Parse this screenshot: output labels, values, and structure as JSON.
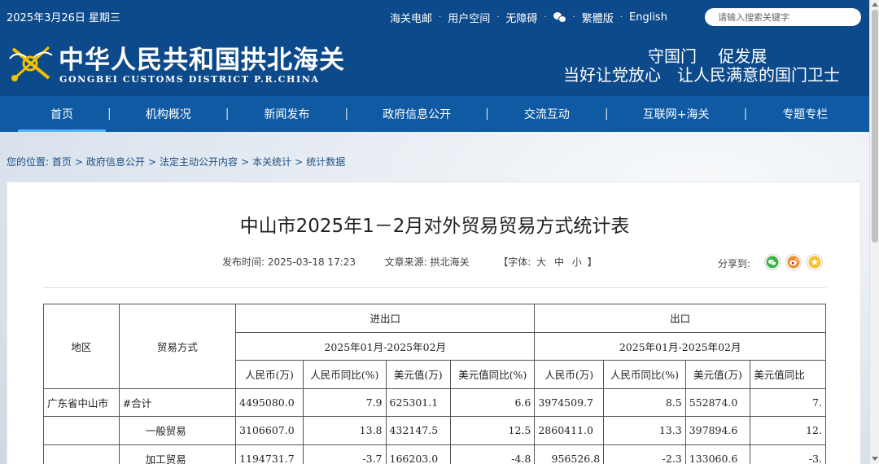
{
  "topbar": {
    "date": "2025年3月26日 星期三",
    "links": [
      "海关电邮",
      "用户空间",
      "无障碍",
      "繁體版",
      "English"
    ],
    "search_placeholder": "请输入搜索关键字"
  },
  "header": {
    "cn_title": "中华人民共和国拱北海关",
    "en_title": "GONGBEI CUSTOMS DISTRICT P.R.CHINA",
    "slogan_line1": "守国门　 促发展",
    "slogan_line2": "当好让党放心　让人民满意的国门卫士"
  },
  "nav": {
    "items": [
      "首页",
      "机构概况",
      "新闻发布",
      "政府信息公开",
      "交流互动",
      "互联网+海关",
      "专题专栏"
    ],
    "active": "首页"
  },
  "breadcrumb": {
    "label": "您的位置:",
    "items": [
      "首页",
      "政府信息公开",
      "法定主动公开内容",
      "本关统计",
      "统计数据"
    ]
  },
  "article": {
    "title": "中山市2025年1－2月对外贸易贸易方式统计表",
    "publish_label": "发布时间:",
    "publish_time": "2025-03-18 17:23",
    "source_label": "文章来源:",
    "source": "拱北海关",
    "font_prefix": "【字体:",
    "font_sizes": [
      "大",
      "中",
      "小"
    ],
    "font_suffix": "】",
    "share_label": "分享到:",
    "share_icons": [
      "wechat-icon",
      "weibo-icon",
      "favorite-star-icon"
    ]
  },
  "table": {
    "h_region": "地区",
    "h_mode": "贸易方式",
    "h_group1": "进出口",
    "h_group2": "出口",
    "h_period1": "2025年01月-2025年02月",
    "h_period2": "2025年01月-2025年02月",
    "col_headers": [
      "人民币(万)",
      "人民币同比(%)",
      "美元值(万)",
      "美元值同比(%)",
      "人民币(万)",
      "人民币同比(%)",
      "美元值(万)",
      "美元值同比"
    ],
    "rows": [
      {
        "region": "广东省中山市",
        "mode": "#合计",
        "values": [
          "4495080.0",
          "7.9",
          "625301.1",
          "6.6",
          "3974509.7",
          "8.5",
          "552874.0",
          "7."
        ]
      },
      {
        "region": "",
        "mode": "一般贸易",
        "values": [
          "3106607.0",
          "13.8",
          "432147.5",
          "12.5",
          "2860411.0",
          "13.3",
          "397894.6",
          "12."
        ]
      },
      {
        "region": "",
        "mode": "加工贸易",
        "values": [
          "1194731.7",
          "-3.7",
          "166203.0",
          "-4.8",
          "956526.8",
          "-2.3",
          "133060.6",
          "-3."
        ]
      }
    ]
  },
  "colors": {
    "header_bg": "#0d4a8b",
    "nav_bg": "#0f5aa3",
    "active_underline": "#4fb3ff",
    "link": "#1d4f86"
  }
}
